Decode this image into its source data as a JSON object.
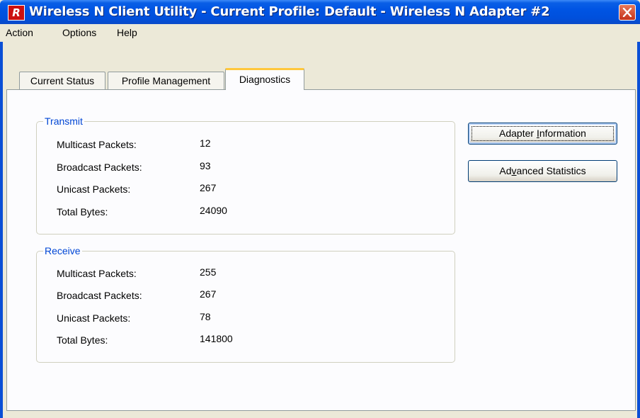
{
  "window": {
    "title": "Wireless N Client Utility - Current Profile: Default - Wireless N Adapter #2",
    "app_icon_letter": "R"
  },
  "menu": {
    "items": [
      "Action",
      "Options",
      "Help"
    ]
  },
  "tabs": [
    {
      "label": "Current Status",
      "active": false
    },
    {
      "label": "Profile Management",
      "active": false
    },
    {
      "label": "Diagnostics",
      "active": true
    }
  ],
  "transmit": {
    "title": "Transmit",
    "rows": [
      {
        "label": "Multicast Packets:",
        "value": "12"
      },
      {
        "label": "Broadcast Packets:",
        "value": "93"
      },
      {
        "label": "Unicast Packets:",
        "value": "267"
      },
      {
        "label": "Total Bytes:",
        "value": "24090"
      }
    ]
  },
  "receive": {
    "title": "Receive",
    "rows": [
      {
        "label": "Multicast Packets:",
        "value": "255"
      },
      {
        "label": "Broadcast Packets:",
        "value": "267"
      },
      {
        "label": "Unicast Packets:",
        "value": "78"
      },
      {
        "label": "Total Bytes:",
        "value": "141800"
      }
    ]
  },
  "buttons": {
    "adapter_info": {
      "before": "Adapter ",
      "mnemonic": "I",
      "after": "nformation"
    },
    "advanced_stats": {
      "before": "Ad",
      "mnemonic": "v",
      "after": "anced Statistics"
    }
  },
  "colors": {
    "titlebar": "#0054e3",
    "legend_text": "#0046d5",
    "active_tab_accent": "#ffc73c",
    "close_button": "#c4331a"
  }
}
